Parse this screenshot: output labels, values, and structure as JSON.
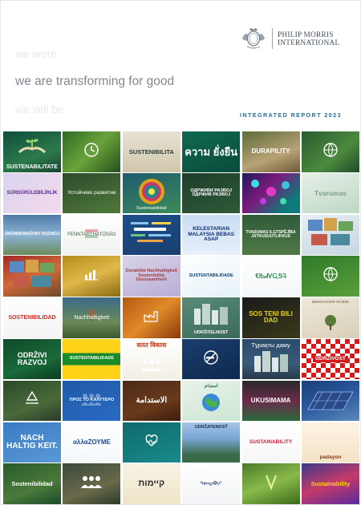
{
  "header": {
    "logo_line1": "PHILIP MORRIS",
    "logo_line2": "INTERNATIONAL",
    "tagline_past": "we were",
    "tagline_present": "we are transforming for good",
    "tagline_future": "we will be",
    "report_title": "INTEGRATED REPORT 2023"
  },
  "tiles": [
    {
      "text": "SUSTENABILITATE",
      "bg": "linear-gradient(160deg,#0f4d3c,#2c7a4b 60%,#194232)",
      "color": "#ffffff",
      "size": 7,
      "weight": "bold",
      "pos": "end",
      "icon": "hands-plant-icon"
    },
    {
      "text": "",
      "bg": "linear-gradient(135deg,#2d6b25,#6aa33a 50%,#244f1e)",
      "color": "#ffffff",
      "size": 7,
      "weight": "normal",
      "pos": "center",
      "icon": "clock-icon"
    },
    {
      "text": "SUSTENIBILITA",
      "bg": "linear-gradient(180deg,#e7e2d3,#cfc7ad)",
      "color": "#2a3a2e",
      "size": 7.5,
      "weight": "bold",
      "pos": "center",
      "icon": ""
    },
    {
      "text": "ความ ยั่งยืน",
      "bg": "linear-gradient(160deg,#0f6a4f,#0a4b3b)",
      "color": "#ffffff",
      "size": 13,
      "weight": "bold",
      "pos": "center",
      "icon": ""
    },
    {
      "text": "DURAPILITY",
      "bg": "linear-gradient(160deg,#5e6b3a,#b8a277 60%,#6d5a37)",
      "color": "#ffffff",
      "size": 8,
      "weight": "bold",
      "pos": "center",
      "icon": ""
    },
    {
      "text": "",
      "bg": "linear-gradient(140deg,#2a5a32,#4c8a3e 60%,#1e4a2c)",
      "color": "#ffffff",
      "size": 7,
      "weight": "normal",
      "pos": "center",
      "icon": "globe-leaf-icon"
    },
    {
      "text": "SÜRDÜRÜLEBİLİRLİK",
      "bg": "linear-gradient(135deg,#d9d4f1,#f3d9ea)",
      "color": "#5b2a8c",
      "size": 6,
      "weight": "bold",
      "pos": "center",
      "icon": ""
    },
    {
      "text": "Устойчиво развитие",
      "bg": "linear-gradient(160deg,#2d4a2c,#4f7a3a)",
      "color": "#ffffff",
      "size": 6.5,
      "weight": "normal",
      "pos": "center",
      "icon": ""
    },
    {
      "text": "Sustentabilidad",
      "bg": "linear-gradient(160deg,#1f5a6e,#3c8c5a)",
      "color": "#ffffff",
      "size": 5.5,
      "weight": "normal",
      "pos": "end",
      "icon": "mandala-icon"
    },
    {
      "text": "ОДРЖИВИ РАЗВОЈ ОДРЖИВ РАЗВОЈ",
      "bg": "linear-gradient(160deg,#1d3e2a,#2f5a39)",
      "color": "#ffffff",
      "size": 5.5,
      "weight": "bold",
      "pos": "center",
      "icon": ""
    },
    {
      "text": "",
      "bg": "linear-gradient(135deg,#1a1a5e,#7a1a7a 40%,#0e7a7a 80%)",
      "color": "#ffffff",
      "size": 7,
      "weight": "normal",
      "pos": "center",
      "icon": "lights-icon"
    },
    {
      "text": "Tvarumas",
      "bg": "linear-gradient(160deg,#e6efe7,#bdd8c4)",
      "color": "#7da08a",
      "size": 8.5,
      "weight": "bold",
      "pos": "center",
      "icon": ""
    },
    {
      "text": "ZRÓWNOWAŻONY ROZWÓJ",
      "bg": "linear-gradient(180deg,#4e7aa6,#8db4d6 50%,#6a8a5a)",
      "color": "#ffffff",
      "size": 5,
      "weight": "bold",
      "pos": "center",
      "icon": ""
    },
    {
      "text": "FENNTARTHATÓSÁG",
      "bg": "linear-gradient(180deg,#ffffff,#eef2ee)",
      "color": "#3a5a3a",
      "size": 6,
      "weight": "normal",
      "pos": "center",
      "icon": "flag-icon"
    },
    {
      "text": "",
      "bg": "linear-gradient(160deg,#1c4f8c,#1a3e6e)",
      "color": "#ffffff",
      "size": 7,
      "weight": "normal",
      "pos": "center",
      "icon": "wordcloud-icon"
    },
    {
      "text": "KELESTARIAN MALAYSIA BEBAS ASAP",
      "bg": "linear-gradient(180deg,#c8dcf2,#e8f0fa)",
      "color": "#0f2f6e",
      "size": 6.5,
      "weight": "bold",
      "pos": "center",
      "icon": ""
    },
    {
      "text": "TVARUMAS ILGTSPĒJĪBA JÄTKUSUUTLIKKUS",
      "bg": "linear-gradient(180deg,#2f5a3a,#4f7a45)",
      "color": "#ffffff",
      "size": 5,
      "weight": "bold",
      "pos": "center",
      "icon": ""
    },
    {
      "text": "",
      "bg": "linear-gradient(160deg,#e8eef3,#c5d6e2)",
      "color": "#2a4a6a",
      "size": 7,
      "weight": "normal",
      "pos": "center",
      "icon": "collage-icon"
    },
    {
      "text": "",
      "bg": "linear-gradient(160deg,#9e2a2a,#d06a3a 50%,#6e4a2a)",
      "color": "#ffffff",
      "size": 7,
      "weight": "normal",
      "pos": "center",
      "icon": "collage-icon"
    },
    {
      "text": "",
      "bg": "linear-gradient(160deg,#b38a1a,#e0b84a 50%,#8a6a10)",
      "color": "#ffffff",
      "size": 7,
      "weight": "normal",
      "pos": "center",
      "icon": "chart-icon"
    },
    {
      "text": "Durabilité Nachhaltigkeit Sostenibilità Duurzaamheid",
      "bg": "linear-gradient(160deg,#d8d2e8,#b9aed6)",
      "color": "#a33a3a",
      "size": 5.5,
      "weight": "bold",
      "pos": "center",
      "icon": ""
    },
    {
      "text": "SUSTENTABILIDADE",
      "bg": "linear-gradient(160deg,#ffffff,#e4f1f8)",
      "color": "#0f3f6e",
      "size": 5.5,
      "weight": "bold",
      "pos": "center",
      "icon": ""
    },
    {
      "text": "ᎧᏏᏗᏙᏩᎦᎸ",
      "bg": "linear-gradient(180deg,#ffffff,#f3f6f8)",
      "color": "#2a8a4a",
      "size": 8,
      "weight": "bold",
      "pos": "center",
      "icon": ""
    },
    {
      "text": "",
      "bg": "linear-gradient(160deg,#2f7a2a,#5aa03a)",
      "color": "#ffffff",
      "size": 7,
      "weight": "normal",
      "pos": "center",
      "icon": "globe-leaf-icon"
    },
    {
      "text": "SOSTENIBILIDAD",
      "bg": "linear-gradient(180deg,#ffffff,#f4f4f4)",
      "color": "#d42a1a",
      "size": 7,
      "weight": "bold",
      "pos": "center",
      "icon": ""
    },
    {
      "text": "Nachhaltigkeit",
      "bg": "linear-gradient(180deg,#3a6a8a,#6a8a5a 60%,#3a5a2a)",
      "color": "#ffffff",
      "size": 7,
      "weight": "normal",
      "pos": "center",
      "icon": "balloon-icon"
    },
    {
      "text": "",
      "bg": "linear-gradient(140deg,#b35a10,#e08a2a 50%,#8a3a0a)",
      "color": "#ffffff",
      "size": 7,
      "weight": "normal",
      "pos": "center",
      "icon": "factory-icon"
    },
    {
      "text": "UDRŽITELNOST",
      "bg": "linear-gradient(160deg,#5a8a7a,#3a6a5a)",
      "color": "#ffffff",
      "size": 5.5,
      "weight": "bold",
      "pos": "end",
      "icon": "city-icon"
    },
    {
      "text": "SOS TENI BILI DAD",
      "bg": "linear-gradient(160deg,#1a1a1a,#3a3a1a)",
      "color": "#e8d21a",
      "size": 8,
      "weight": "bold",
      "pos": "center",
      "icon": ""
    },
    {
      "text": "ВИКОНАННЯ НАЛЕЖ",
      "bg": "linear-gradient(160deg,#efe9dc,#d9cfb7)",
      "color": "#6a5a3a",
      "size": 4.5,
      "weight": "normal",
      "pos": "start",
      "icon": "tree-icon"
    },
    {
      "text": "ODRŽIVI RAZVOJ",
      "bg": "linear-gradient(160deg,#0e4a2a,#1a6a3a 60%,#0c3a22)",
      "color": "#ffffff",
      "size": 9,
      "weight": "bold",
      "pos": "center",
      "icon": ""
    },
    {
      "text": "SUSTENTABILIDADE",
      "bg": "linear-gradient(180deg,#ffd21a 0,#ffd21a 35%,#1a8a2a 35%,#1a8a2a 65%,#ffd21a 65%)",
      "color": "#ffffff",
      "size": 5.5,
      "weight": "bold",
      "pos": "center",
      "icon": ""
    },
    {
      "text": "सतत विकास",
      "bg": "linear-gradient(180deg,#ffffff,#f2efe4)",
      "color": "#c43a1a",
      "size": 8,
      "weight": "bold",
      "pos": "start",
      "icon": "people-icon"
    },
    {
      "text": "",
      "bg": "linear-gradient(160deg,#1a3e6e,#0e2a4e)",
      "color": "#ffffff",
      "size": 7,
      "weight": "normal",
      "pos": "center",
      "icon": "no-smoking-icon"
    },
    {
      "text": "Тұрақты даму",
      "bg": "linear-gradient(180deg,#2a4a6a,#3a5a7a 60%,#2a3a4a)",
      "color": "#ffffff",
      "size": 7.5,
      "weight": "normal",
      "pos": "start",
      "icon": "city-icon"
    },
    {
      "text": "ODRŽIVOST",
      "bg": "repeating-conic-gradient(#d41a1a 0 25%, #ffffff 0 50%) 0 0/12px 12px",
      "color": "#ffffff",
      "size": 6.5,
      "weight": "bold",
      "pos": "center",
      "icon": ""
    },
    {
      "text": "",
      "bg": "linear-gradient(160deg,#2a4a2a,#4a6a3a 60%,#2a3a2a)",
      "color": "#ffffff",
      "size": 7,
      "weight": "normal",
      "pos": "center",
      "icon": "recycle-icon"
    },
    {
      "text": "ΠΡΟΣ ΤΟ ΚΑΛΥΤΕΡΟ",
      "bg": "linear-gradient(160deg,#1f5aa6,#2a6ac4)",
      "color": "#ffffff",
      "size": 5.5,
      "weight": "bold",
      "pos": "center",
      "icon": "people-icon"
    },
    {
      "text": "الاستدامة",
      "bg": "linear-gradient(160deg,#4a2a1a,#6a3a1a 60%,#3a1e10)",
      "color": "#ffffff",
      "size": 10,
      "weight": "bold",
      "pos": "center",
      "icon": ""
    },
    {
      "text": "استدام",
      "bg": "linear-gradient(160deg,#e8f3ea,#cde6d3)",
      "color": "#1a7a3a",
      "size": 6,
      "weight": "bold",
      "pos": "start",
      "icon": "globe-icon"
    },
    {
      "text": "UKUSIMAMA",
      "bg": "linear-gradient(180deg,#2a2a2a,#6a2a4a 50%,#2a6a3a)",
      "color": "#ffffff",
      "size": 8,
      "weight": "bold",
      "pos": "center",
      "icon": ""
    },
    {
      "text": "",
      "bg": "linear-gradient(160deg,#1a3e7a,#2a5a9e 50%,#5a8aba)",
      "color": "#ffffff",
      "size": 7,
      "weight": "normal",
      "pos": "center",
      "icon": "solar-panels-icon"
    },
    {
      "text": "NACH HALTIG KEIT.",
      "bg": "linear-gradient(160deg,#3a7ac4,#5a9ad6)",
      "color": "#ffffff",
      "size": 10,
      "weight": "bold",
      "pos": "center",
      "icon": ""
    },
    {
      "text": "αλλαΖΟΥΜΕ",
      "bg": "linear-gradient(180deg,#ffffff,#f4f7fa)",
      "color": "#1a4a9e",
      "size": 8,
      "weight": "bold",
      "pos": "center",
      "icon": ""
    },
    {
      "text": "",
      "bg": "linear-gradient(160deg,#0e6a6e,#1a8a8a)",
      "color": "#ffffff",
      "size": 7,
      "weight": "normal",
      "pos": "center",
      "icon": "heart-hands-icon"
    },
    {
      "text": "UDRŽATENOSŤ",
      "bg": "linear-gradient(180deg,#a6c4e6,#7aa6d6 40%,#3a6a4a 80%)",
      "color": "#1a2a4a",
      "size": 5.5,
      "weight": "bold",
      "pos": "start",
      "icon": ""
    },
    {
      "text": "SUSTAINABILITY",
      "bg": "linear-gradient(180deg,#ffffff,#f6f6f6)",
      "color": "#d41a3a",
      "size": 6.5,
      "weight": "bold",
      "pos": "center",
      "icon": ""
    },
    {
      "text": "padayon",
      "bg": "linear-gradient(180deg,#fdf3e4,#f4e2c6)",
      "color": "#8a3a1a",
      "size": 6.5,
      "weight": "bold",
      "pos": "end",
      "icon": ""
    },
    {
      "text": "Sostenibilidad",
      "bg": "linear-gradient(160deg,#2a5a2a,#4a7a3a 60%,#1a4a2a)",
      "color": "#ffffff",
      "size": 7.5,
      "weight": "bold",
      "pos": "center",
      "icon": ""
    },
    {
      "text": "",
      "bg": "linear-gradient(160deg,#3a4a3a,#6a6a4a 60%,#2a3a2a)",
      "color": "#ffffff",
      "size": 7,
      "weight": "normal",
      "pos": "center",
      "icon": "people-icon"
    },
    {
      "text": "קיימות",
      "bg": "linear-gradient(180deg,#f7f3e6,#ede4c8)",
      "color": "#2a2a2a",
      "size": 11,
      "weight": "bold",
      "pos": "center",
      "icon": ""
    },
    {
      "text": "ᠲᠣᠭᠲᠠᠪᠤᠷᠢ",
      "bg": "linear-gradient(180deg,#ffffff,#f2f4f6)",
      "color": "#1a3a6a",
      "size": 6,
      "weight": "normal",
      "pos": "center",
      "icon": ""
    },
    {
      "text": "",
      "bg": "linear-gradient(160deg,#4a7a2a,#8aba4a 50%,#3a6a1a)",
      "color": "#ffffff",
      "size": 7,
      "weight": "normal",
      "pos": "center",
      "icon": "chevron-icon"
    },
    {
      "text": "Sustainability",
      "bg": "linear-gradient(160deg,#3a3a8a,#c43a6a 50%,#5a2a9e)",
      "color": "#ffd21a",
      "size": 7.5,
      "weight": "bold",
      "pos": "center",
      "icon": ""
    }
  ]
}
